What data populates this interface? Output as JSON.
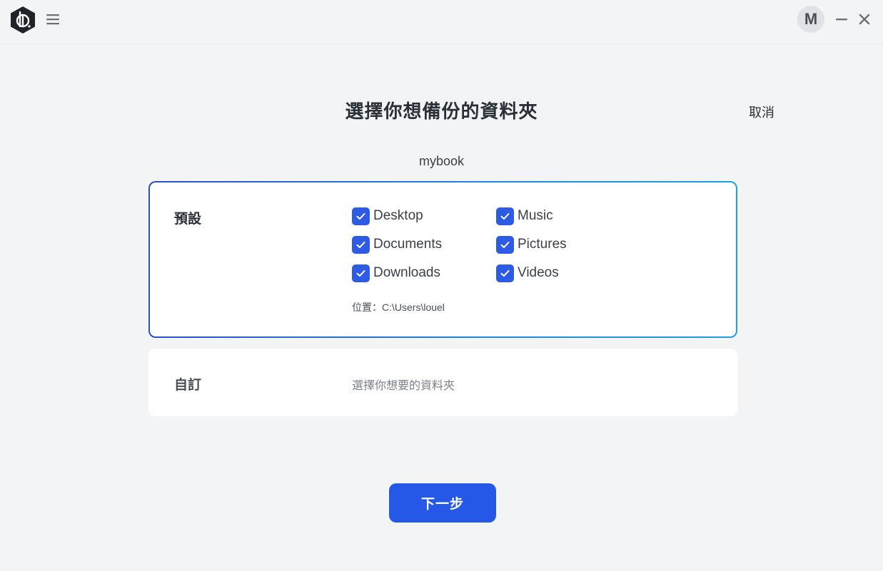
{
  "app": {
    "logo_icon": "backup-app-logo-icon",
    "menu_icon": "hamburger-menu-icon",
    "avatar_initial": "M",
    "minimize_icon": "minimize-icon",
    "close_icon": "close-icon"
  },
  "header": {
    "title": "選擇你想備份的資料夾",
    "cancel_label": "取消",
    "device_name": "mybook"
  },
  "default_card": {
    "label": "預設",
    "folders": [
      {
        "name": "Desktop",
        "checked": true
      },
      {
        "name": "Music",
        "checked": true
      },
      {
        "name": "Documents",
        "checked": true
      },
      {
        "name": "Pictures",
        "checked": true
      },
      {
        "name": "Downloads",
        "checked": true
      },
      {
        "name": "Videos",
        "checked": true
      }
    ],
    "location": "位置：C:\\Users\\louel"
  },
  "custom_card": {
    "label": "自訂",
    "hint": "選擇你想要的資料夾"
  },
  "footer": {
    "next_label": "下一步"
  },
  "colors": {
    "accent": "#2558e6",
    "checkbox": "#2d5be3",
    "background": "#f2f4f6"
  }
}
